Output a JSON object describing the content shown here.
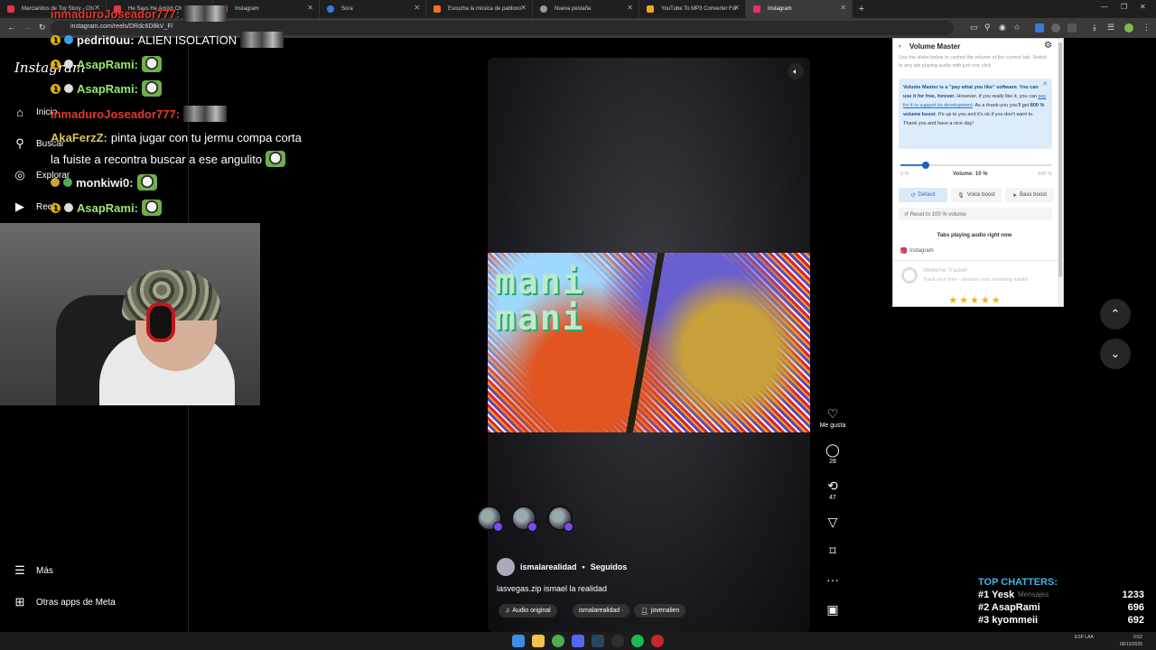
{
  "browser": {
    "tabs": [
      {
        "label": "Marcianitos de Toy Story - Chi",
        "color": "#e2344a",
        "active": false
      },
      {
        "label": "He Says He Amish Ch",
        "color": "#e2344a",
        "active": false
      },
      {
        "label": "Instagram",
        "color": "#e1306c",
        "active": false
      },
      {
        "label": "Sora",
        "color": "#3d7ae8",
        "active": false
      },
      {
        "label": "Escucha la música de pabloxo",
        "color": "#f36f21",
        "active": false
      },
      {
        "label": "Nueva pestaña",
        "color": "#999999",
        "active": false
      },
      {
        "label": "YouTube To MP3 Converter For",
        "color": "#f0a71c",
        "active": false
      },
      {
        "label": "Instagram",
        "color": "#e1306c",
        "active": true
      }
    ],
    "url": "instagram.com/reels/DRdc6D8kV_F/"
  },
  "instagram": {
    "logo": "Instagram",
    "nav": [
      {
        "label": "Inicio",
        "icon": "home-icon"
      },
      {
        "label": "Buscar",
        "icon": "search-icon"
      },
      {
        "label": "Explorar",
        "icon": "compass-icon"
      },
      {
        "label": "Reels",
        "icon": "reels-icon"
      }
    ],
    "more_label": "Más",
    "meta_label": "Otras apps de Meta",
    "reel": {
      "video_text_line1": "mani",
      "video_text_line2": "mani",
      "like_label": "Me gusta",
      "comments_count": "28",
      "reposts_count": "47",
      "author": "ismalarealidad",
      "following_label": "Seguidos",
      "caption": "lasvegas.zip ismael la realidad",
      "audio_label": "Audio original",
      "audio_author": "ismalarealidad ·",
      "tagged_user": "jovenalien"
    }
  },
  "volume_master": {
    "title": "Volume Master",
    "description": "Use the slider below to control the volume of the current tab. Switch to any tab playing audio with just one click",
    "promo_bold": "Volume Master is a \"pay what you like\" software. You can use it for free, forever.",
    "promo_pre": "However, if you really like it, you can",
    "promo_link": "pay for it to support its development",
    "promo_post": ". As a thank-you you'll get",
    "promo_bold2": "800 % volume boost",
    "promo_end": ". It's up to you and it's ok if you don't want to. Thank you and have a nice day!",
    "slider_min": "0 %",
    "slider_max": "600 %",
    "volume_label": "Volume: 10 %",
    "volume_fraction": 0.1667,
    "mode_default": "Default",
    "mode_voice": "Voice boost",
    "mode_bass": "Bass boost",
    "reset_label": "Reset to 100 % volume",
    "playing_title": "Tabs playing audio right now",
    "playing_tab": "Instagram",
    "tracker_title": "Webtime Tracker",
    "tracker_desc": "Track your time - discover your browsing habits!",
    "stars": "★★★★★"
  },
  "stream_chat": [
    {
      "name": "inmaduroJoseador777:",
      "msg": "",
      "name_class": "chat-name-red"
    },
    {
      "name": "pedrit0uu:",
      "msg": "ALIEN ISOLATION",
      "name_class": "chat-name-white"
    },
    {
      "name": "AsapRami:",
      "msg": "",
      "name_class": "chat-name-green"
    },
    {
      "name": "AsapRami:",
      "msg": "",
      "name_class": "chat-name-green"
    },
    {
      "name": "inmaduroJoseador777:",
      "msg": "",
      "name_class": "chat-name-red"
    },
    {
      "name": "AkaFerzZ:",
      "msg": "pinta jugar con tu jermu compa corta",
      "name_class": "chat-name-yellow"
    },
    {
      "name": "",
      "msg": "la fuiste a recontra buscar a ese angulito",
      "name_class": "chat-name-white"
    },
    {
      "name": "monkiwi0:",
      "msg": "",
      "name_class": "chat-name-white"
    },
    {
      "name": "AsapRami:",
      "msg": "",
      "name_class": "chat-name-green"
    }
  ],
  "top_chatters": {
    "title": "TOP CHATTERS:",
    "mensajes": "Mensajes",
    "rows": [
      {
        "rank": "#1",
        "name": "Yesk",
        "count": "1233"
      },
      {
        "rank": "#2",
        "name": "AsapRami",
        "count": "696"
      },
      {
        "rank": "#3",
        "name": "kyommeii",
        "count": "692"
      }
    ]
  },
  "taskbar": {
    "lang": "ESP LAA",
    "time": "0:52",
    "date": "06/12/2025"
  }
}
